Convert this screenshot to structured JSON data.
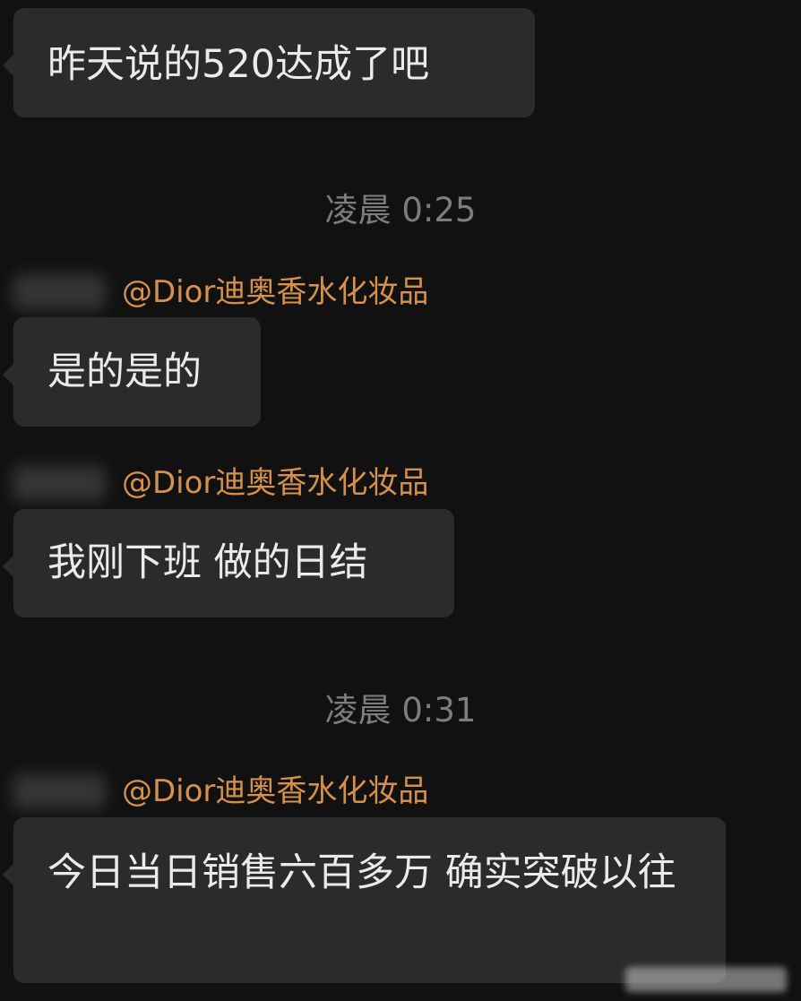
{
  "messages": [
    {
      "text": "昨天说的520达成了吧"
    },
    {
      "sender_mention": "@Dior迪奥香水化妆品",
      "text": "是的是的"
    },
    {
      "sender_mention": "@Dior迪奥香水化妆品",
      "text": "我刚下班 做的日结"
    },
    {
      "sender_mention": "@Dior迪奥香水化妆品",
      "text": "今日当日销售六百多万 确实突破以往"
    }
  ],
  "timestamps": [
    "凌晨 0:25",
    "凌晨 0:31"
  ],
  "colors": {
    "background": "#111111",
    "bubble": "#2b2b2b",
    "mention": "#d6904d",
    "timestamp": "#7d7d7d"
  }
}
